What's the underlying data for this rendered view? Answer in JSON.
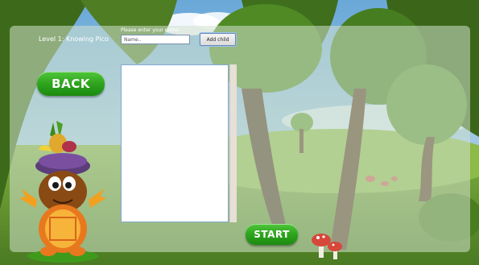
{
  "level_title": "Level 1: Knowing Pico",
  "name_prompt": "Please enter your name:",
  "name_input": {
    "value": "",
    "placeholder": "Name.."
  },
  "add_child_label": "Add child",
  "back_label": "BACK",
  "start_label": "START",
  "children_list": [],
  "colors": {
    "button_green": "#2ea41e",
    "panel_overlay": "#d2e1cd",
    "list_border": "#7faad6"
  },
  "mascot_icon": "pico-turtle-mascot",
  "background": "forest-scene"
}
